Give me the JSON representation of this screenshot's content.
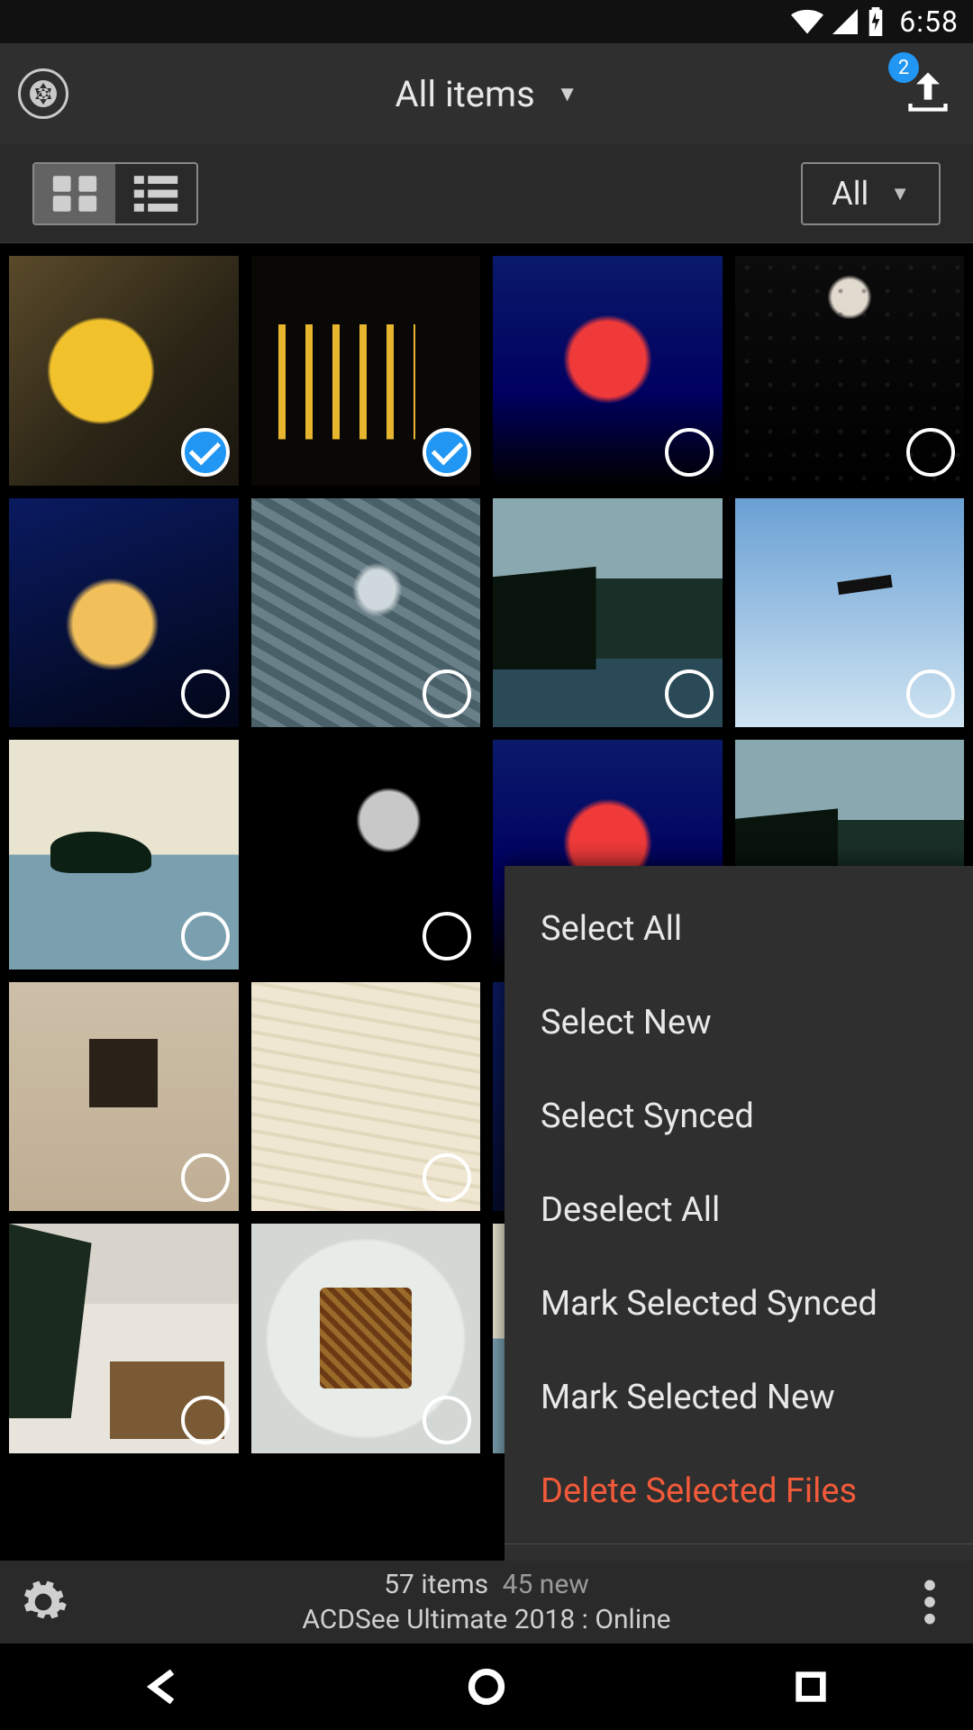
{
  "status": {
    "time": "6:58"
  },
  "appbar": {
    "title": "All items",
    "upload_badge": "2"
  },
  "toolbar": {
    "filter_label": "All"
  },
  "grid": {
    "items": [
      {
        "sel": true,
        "cls": "leaf",
        "bordered": false
      },
      {
        "sel": true,
        "cls": "bottles",
        "bordered": false
      },
      {
        "sel": false,
        "cls": "neon",
        "bordered": false
      },
      {
        "sel": false,
        "cls": "man",
        "bordered": false
      },
      {
        "sel": false,
        "cls": "tulip",
        "bordered": false
      },
      {
        "sel": false,
        "cls": "whale",
        "bordered": false
      },
      {
        "sel": false,
        "cls": "coast",
        "bordered": false
      },
      {
        "sel": false,
        "cls": "eagle",
        "bordered": false
      },
      {
        "sel": false,
        "cls": "island",
        "bordered": false
      },
      {
        "sel": false,
        "cls": "moon",
        "bordered": false
      },
      {
        "sel": false,
        "cls": "neon",
        "bordered": false
      },
      {
        "sel": false,
        "cls": "coast",
        "bordered": false
      },
      {
        "sel": false,
        "cls": "interior",
        "bordered": true
      },
      {
        "sel": false,
        "cls": "book",
        "bordered": true
      },
      {
        "sel": false,
        "cls": "tulip",
        "bordered": true
      },
      {
        "sel": false,
        "cls": "man",
        "bordered": true
      },
      {
        "sel": false,
        "cls": "snow",
        "bordered": true
      },
      {
        "sel": false,
        "cls": "waffle",
        "bordered": true
      },
      {
        "sel": false,
        "cls": "island",
        "bordered": true
      },
      {
        "sel": false,
        "cls": "whale",
        "bordered": true
      }
    ]
  },
  "context_menu": {
    "items": [
      {
        "label": "Select All",
        "danger": false
      },
      {
        "label": "Select New",
        "danger": false
      },
      {
        "label": "Select Synced",
        "danger": false
      },
      {
        "label": "Deselect All",
        "danger": false
      },
      {
        "label": "Mark Selected Synced",
        "danger": false
      },
      {
        "label": "Mark Selected New",
        "danger": false
      },
      {
        "label": "Delete Selected Files",
        "danger": true
      }
    ]
  },
  "bottom": {
    "count": "57 items",
    "new_count": "45 new",
    "status": "ACDSee Ultimate 2018 : Online"
  }
}
